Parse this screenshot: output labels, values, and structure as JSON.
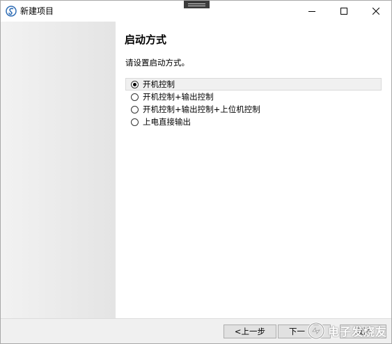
{
  "window": {
    "title": "新建项目",
    "app_icon": "app-logo-icon",
    "controls": [
      "minimize-icon",
      "maximize-icon",
      "close-icon"
    ]
  },
  "page": {
    "title": "启动方式",
    "instruction": "请设置启动方式。"
  },
  "options": [
    {
      "label": "开机控制",
      "checked": true
    },
    {
      "label": "开机控制+输出控制",
      "checked": false
    },
    {
      "label": "开机控制+输出控制+上位机控制",
      "checked": false
    },
    {
      "label": "上电直接输出",
      "checked": false
    }
  ],
  "buttons": {
    "back": "<上一步",
    "next": "下一",
    "cancel": "取消"
  },
  "watermark": {
    "text": "电子发烧友"
  },
  "colors": {
    "sidebar": "#e8e8e8",
    "bottom_bar": "#f0f0f0",
    "button_face": "#e1e1e1",
    "selected_row": "#f0f0f0"
  }
}
